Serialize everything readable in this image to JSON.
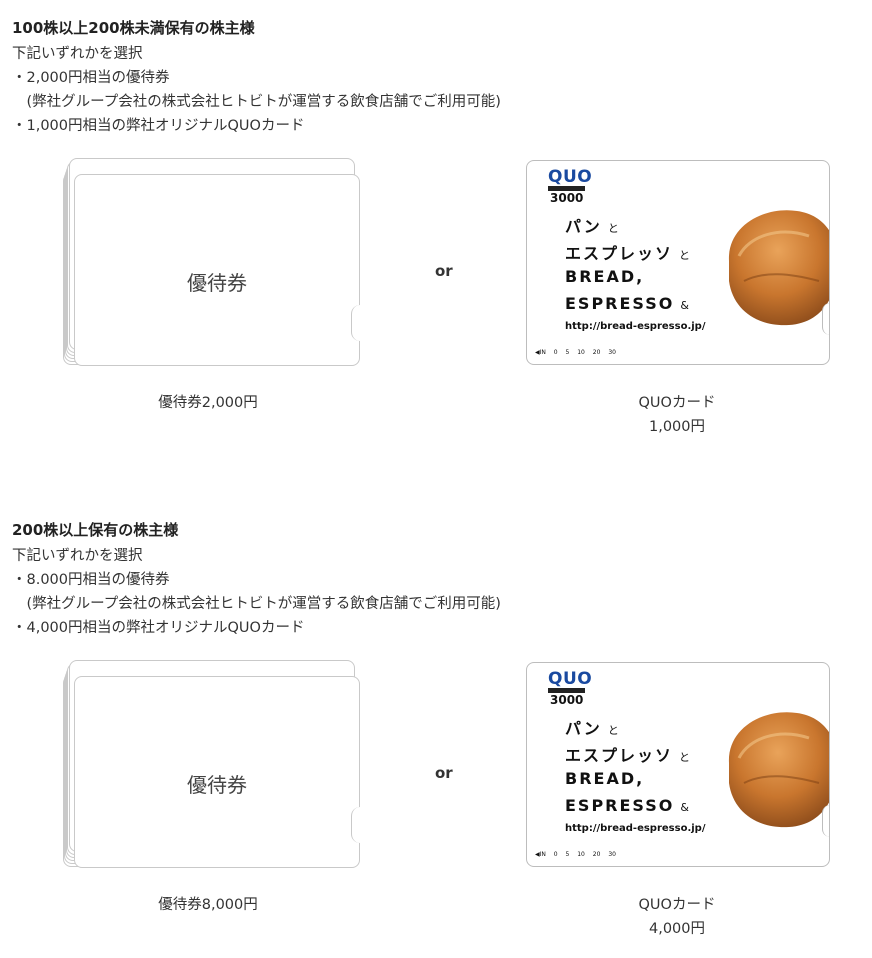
{
  "sections": [
    {
      "title": "100株以上200株未満保有の株主様",
      "lines": [
        "下記いずれかを選択",
        "・2,000円相当の優待券",
        "　(弊社グループ会社の株式会社ヒトビトが運営する飲食店舗でご利用可能)",
        "・1,000円相当の弊社オリジナルQUOカード"
      ],
      "voucher_label": "優待券",
      "or_label": "or",
      "voucher_caption": "優待券2,000円",
      "quo_caption_line1": "QUOカード",
      "quo_caption_line2": "1,000円"
    },
    {
      "title": "200株以上保有の株主様",
      "lines": [
        "下記いずれかを選択",
        "・8.000円相当の優待券",
        "　(弊社グループ会社の株式会社ヒトビトが運営する飲食店舗でご利用可能)",
        "・4,000円相当の弊社オリジナルQUOカード"
      ],
      "voucher_label": "優待券",
      "or_label": "or",
      "voucher_caption": "優待券8,000円",
      "quo_caption_line1": "QUOカード",
      "quo_caption_line2": "4,000円"
    }
  ],
  "quo_card": {
    "logo": "QUO",
    "amount": "3000",
    "headline1": "パン",
    "headline1_small": "と",
    "headline2": "エスプレッソ",
    "headline2_small": "と",
    "headline3": "BREAD,",
    "headline4": "ESPRESSO",
    "headline4_small": "&",
    "url": "http://bread-espresso.jp/",
    "scale": "◀IN 0 5 10 20 30",
    "logo_color": "#1a4aa0"
  }
}
